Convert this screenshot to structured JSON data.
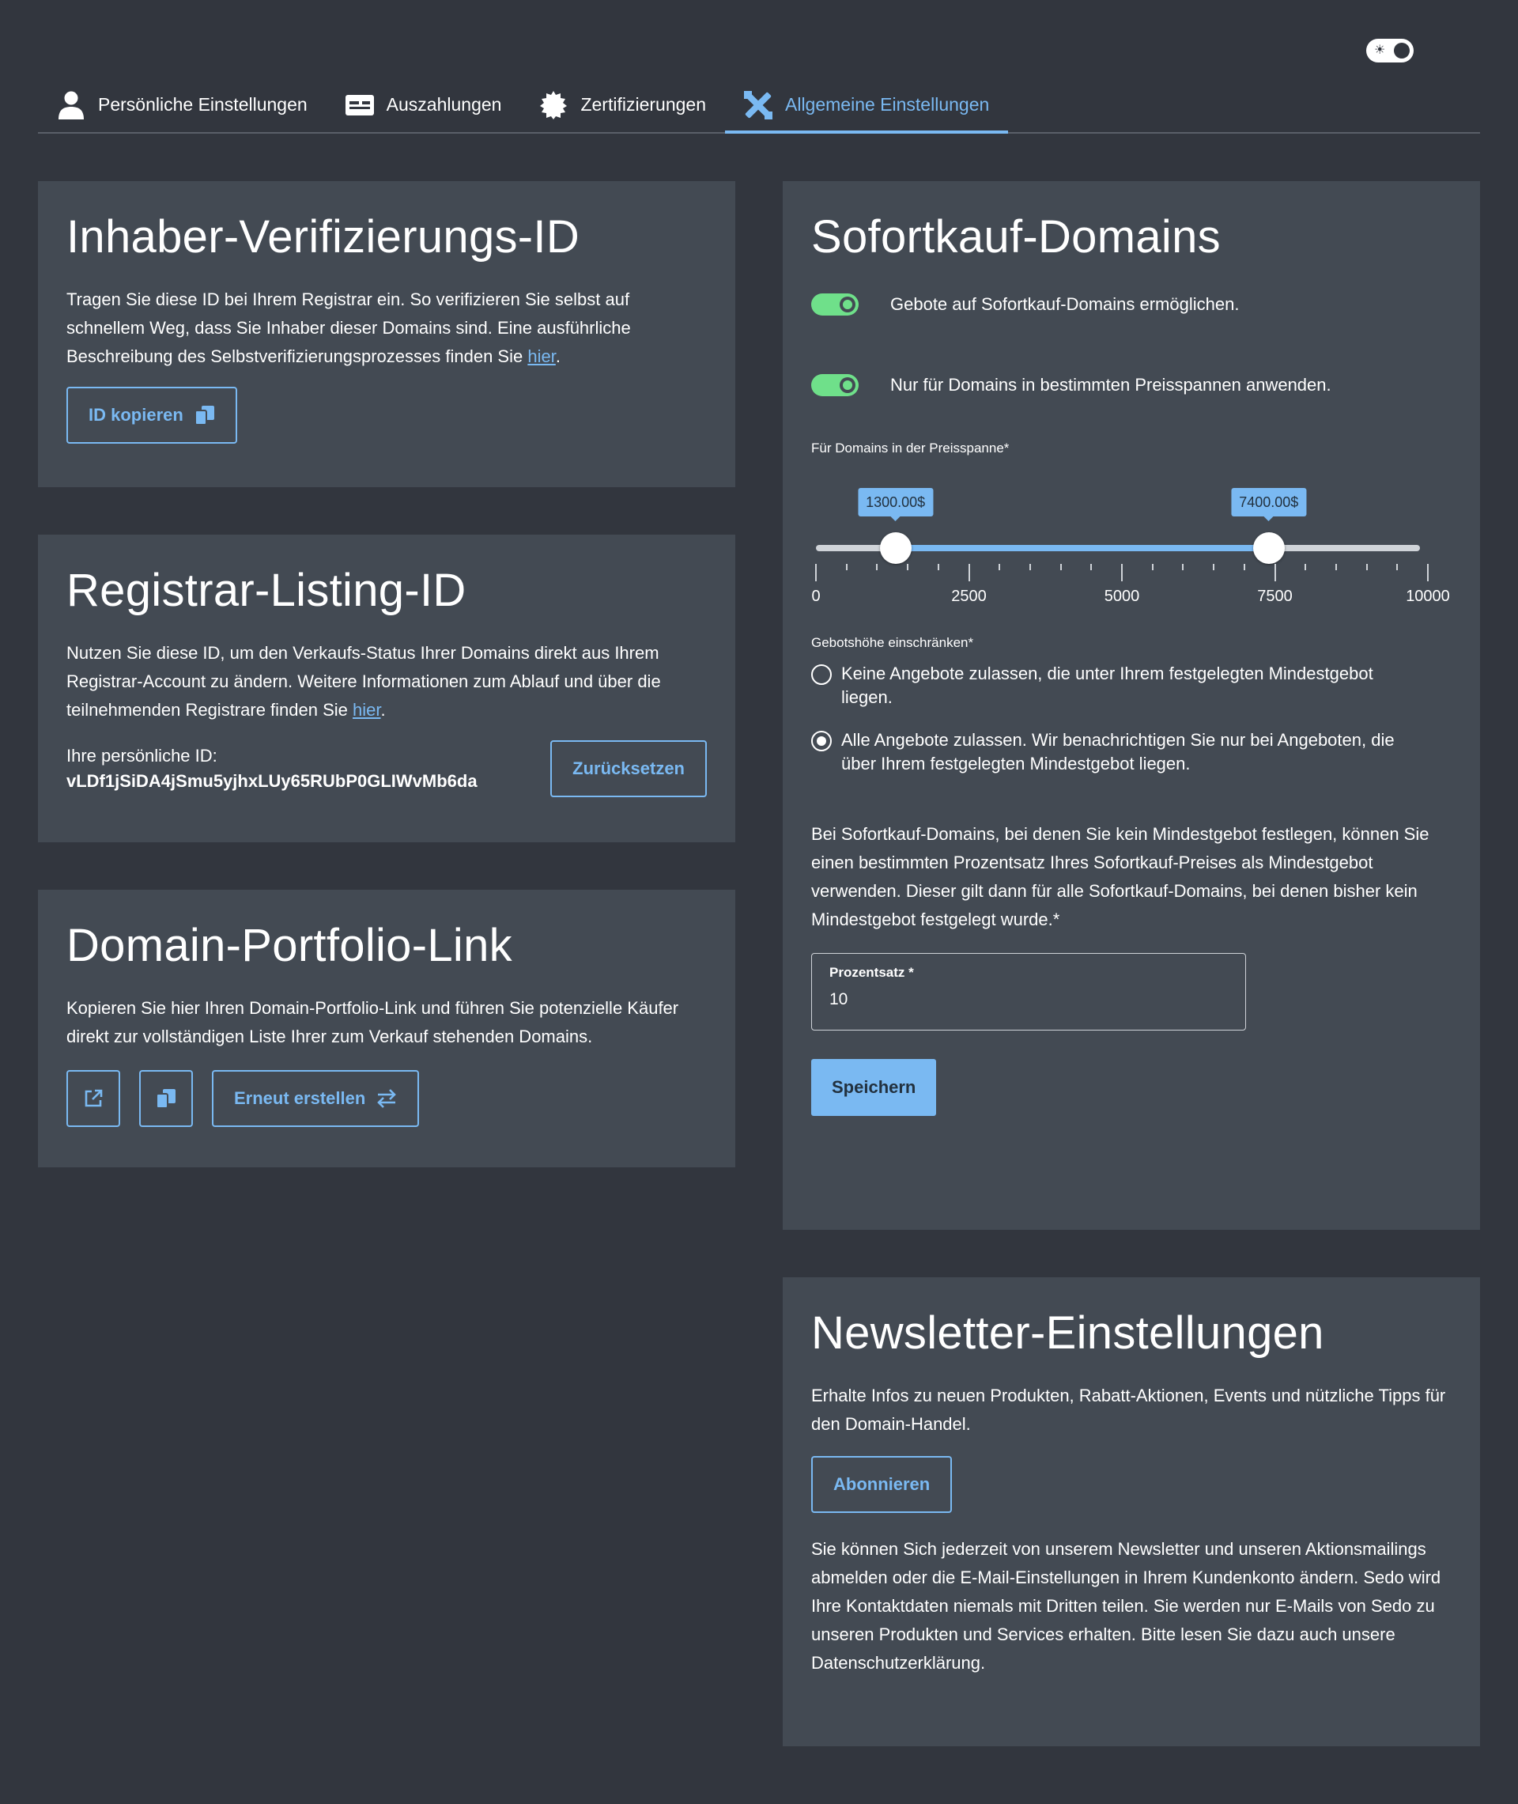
{
  "nav": {
    "tabs": [
      {
        "label": "Persönliche Einstellungen",
        "icon": "user-icon"
      },
      {
        "label": "Auszahlungen",
        "icon": "id-card-icon"
      },
      {
        "label": "Zertifizierungen",
        "icon": "certificate-icon"
      },
      {
        "label": "Allgemeine Einstellungen",
        "icon": "tools-icon",
        "active": true
      }
    ]
  },
  "colors": {
    "accent": "#7ab9f2",
    "toggle_on": "#6fe08a",
    "background": "#32363e",
    "card": "#434a53"
  },
  "owner_verification": {
    "title": "Inhaber-Verifizierungs-ID",
    "description": "Tragen Sie diese ID bei Ihrem Registrar ein. So verifizieren Sie selbst auf schnellem Weg, dass Sie Inhaber dieser Domains sind. Eine ausführliche Beschreibung des Selbstverifizierungsprozesses finden Sie ",
    "link": "hier",
    "after_link": ".",
    "copy_button": "ID kopieren"
  },
  "registrar_listing": {
    "title": "Registrar-Listing-ID",
    "description": "Nutzen Sie diese ID, um den Verkaufs-Status Ihrer Domains direkt aus Ihrem Registrar-Account zu ändern. Weitere Informationen zum Ablauf und über die teilnehmenden Registrare finden Sie ",
    "link": "hier",
    "after_link": ".",
    "id_label": "Ihre persönliche ID:",
    "id_value": "vLDf1jSiDA4jSmu5yjhxLUy65RUbP0GLIWvMb6da",
    "reset_button": "Zurücksetzen"
  },
  "portfolio_link": {
    "title": "Domain-Portfolio-Link",
    "description": "Kopieren Sie hier Ihren Domain-Portfolio-Link und führen Sie potenzielle Käufer direkt zur vollständigen Liste Ihrer zum Verkauf stehenden Domains.",
    "regenerate_button": "Erneut erstellen"
  },
  "instant_buy": {
    "title": "Sofortkauf-Domains",
    "toggle1_label": "Gebote auf Sofortkauf-Domains ermöglichen.",
    "toggle2_label": "Nur für Domains in bestimmten Preisspannen anwenden.",
    "range_label": "Für Domains in der Preisspanne*",
    "slider": {
      "min": 0,
      "max": 10000,
      "low": 1300,
      "high": 7400,
      "low_label": "1300.00$",
      "high_label": "7400.00$",
      "tick_labels": [
        "0",
        "2500",
        "5000",
        "7500",
        "10000"
      ]
    },
    "bid_limit_label": "Gebotshöhe einschränken*",
    "radio1": "Keine Angebote zulassen, die unter Ihrem festgelegten Mindestgebot liegen.",
    "radio2": "Alle Angebote zulassen. Wir benachrichtigen Sie nur bei Angeboten, die über Ihrem festgelegten Mindestgebot liegen.",
    "percentage_text": "Bei Sofortkauf-Domains, bei denen Sie kein Mindestgebot festlegen, können Sie einen bestimmten Prozentsatz Ihres Sofortkauf-Preises als Mindestgebot verwenden. Dieser gilt dann für alle Sofortkauf-Domains, bei denen bisher kein Mindestgebot festgelegt wurde.*",
    "percentage_label": "Prozentsatz *",
    "percentage_value": "10",
    "save_button": "Speichern"
  },
  "newsletter": {
    "title": "Newsletter-Einstellungen",
    "description": "Erhalte Infos zu neuen Produkten, Rabatt-Aktionen, Events und nützliche Tipps für den Domain-Handel.",
    "subscribe_button": "Abonnieren",
    "footer_text": "Sie können Sich jederzeit von unserem Newsletter und unseren Aktionsmailings abmelden oder die E-Mail-Einstellungen in Ihrem Kundenkonto ändern. Sedo wird Ihre Kontaktdaten niemals mit Dritten teilen. Sie werden nur E-Mails von Sedo zu unseren Produkten und Services erhalten. Bitte lesen Sie dazu auch unsere Datenschutzerklärung."
  }
}
